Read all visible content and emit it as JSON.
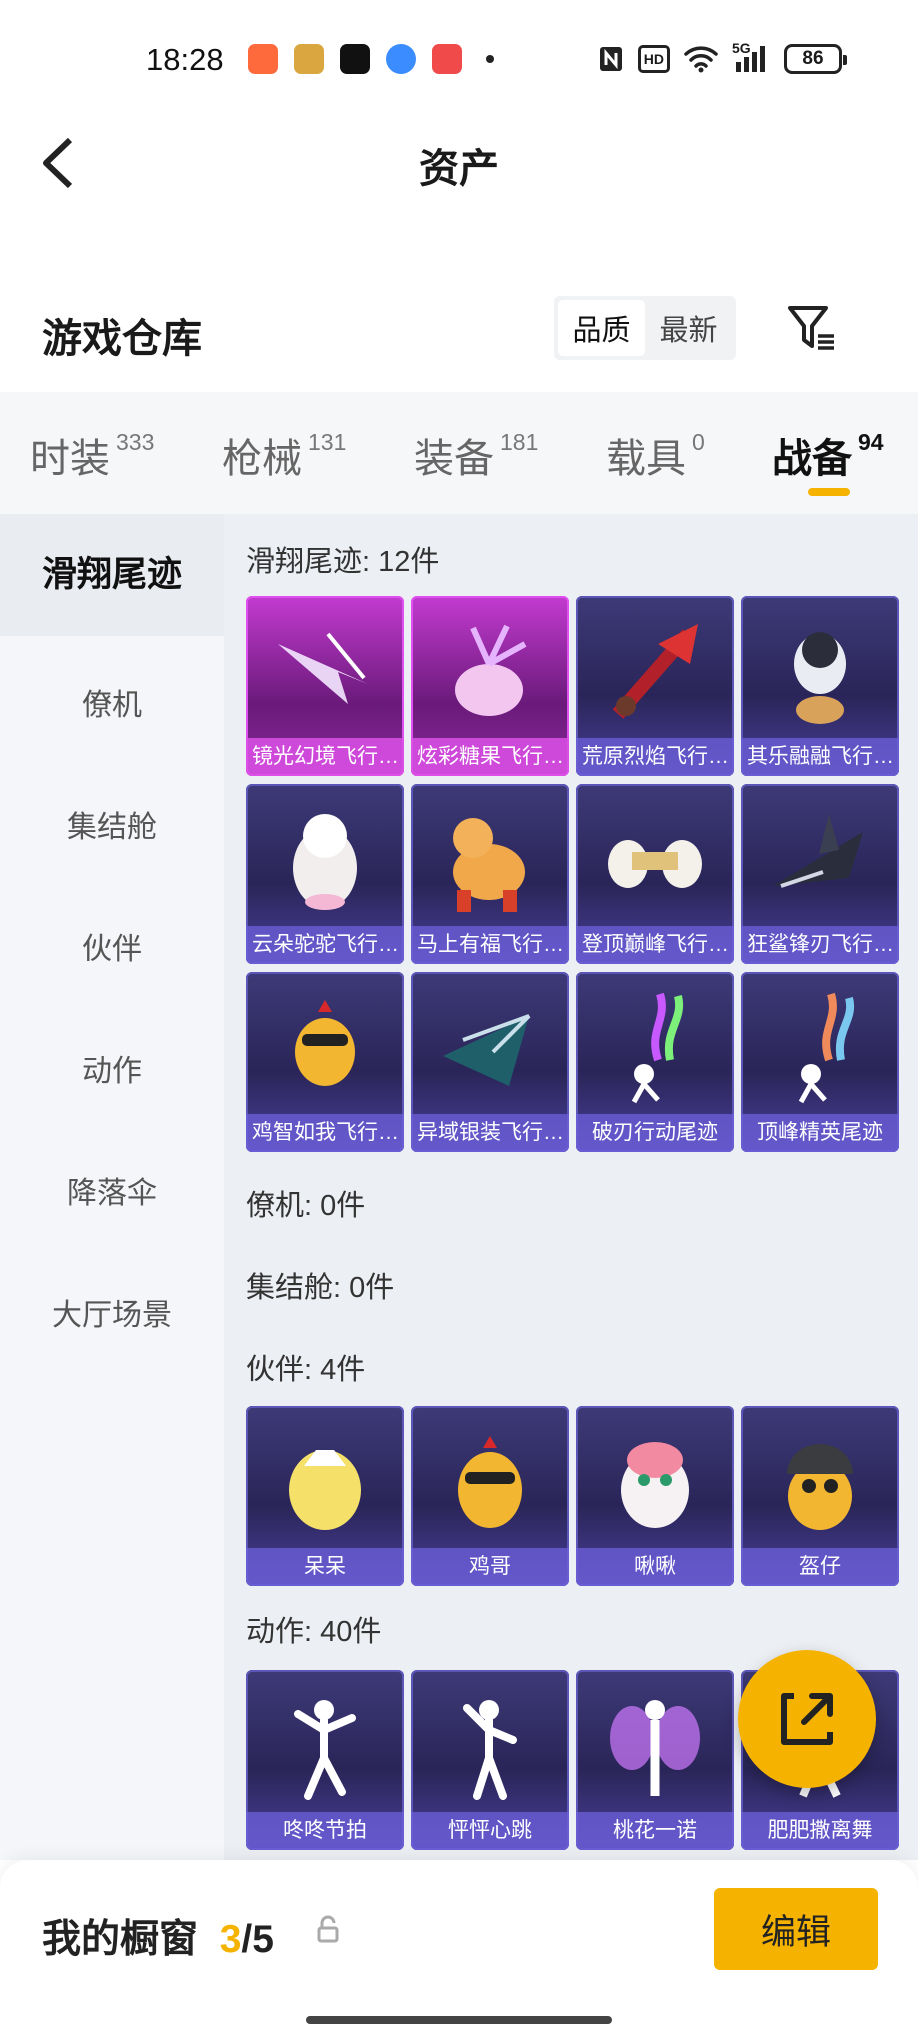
{
  "status": {
    "time": "18:28",
    "hd": "HD",
    "network": "5G",
    "battery": "86"
  },
  "header": {
    "title": "资产"
  },
  "warehouse": {
    "title": "游戏仓库",
    "sort_options": [
      "品质",
      "最新"
    ],
    "active_sort": "品质"
  },
  "tabs": [
    {
      "label": "时装",
      "count": "333"
    },
    {
      "label": "枪械",
      "count": "131"
    },
    {
      "label": "装备",
      "count": "181"
    },
    {
      "label": "载具",
      "count": "0"
    },
    {
      "label": "战备",
      "count": "94"
    }
  ],
  "active_tab": "战备",
  "sidebar": {
    "categories": [
      "滑翔尾迹",
      "僚机",
      "集结舱",
      "伙伴",
      "动作",
      "降落伞",
      "大厅场景"
    ],
    "active": "滑翔尾迹"
  },
  "sections": {
    "glide": {
      "title": "滑翔尾迹: 12件",
      "items": [
        "镜光幻境飞行…",
        "炫彩糖果飞行…",
        "荒原烈焰飞行…",
        "其乐融融飞行…",
        "云朵驼驼飞行…",
        "马上有福飞行…",
        "登顶巅峰飞行…",
        "狂鲨锋刃飞行…",
        "鸡智如我飞行…",
        "异域银装飞行…",
        "破刃行动尾迹",
        "顶峰精英尾迹"
      ]
    },
    "wingman": {
      "title": "僚机: 0件"
    },
    "pod": {
      "title": "集结舱: 0件"
    },
    "partner": {
      "title": "伙伴: 4件",
      "items": [
        "呆呆",
        "鸡哥",
        "啾啾",
        "盔仔"
      ]
    },
    "action": {
      "title": "动作: 40件",
      "items": [
        "咚咚节拍",
        "怦怦心跳",
        "桃花一诺",
        "肥肥撒离舞"
      ]
    }
  },
  "bottom": {
    "showcase_label": "我的橱窗",
    "count_current": "3",
    "count_sep": "/",
    "count_total": "5",
    "edit_label": "编辑"
  },
  "colors": {
    "accent": "#f5b300",
    "card_purple": "#3d3a78",
    "card_pink": "#c33bd0"
  }
}
